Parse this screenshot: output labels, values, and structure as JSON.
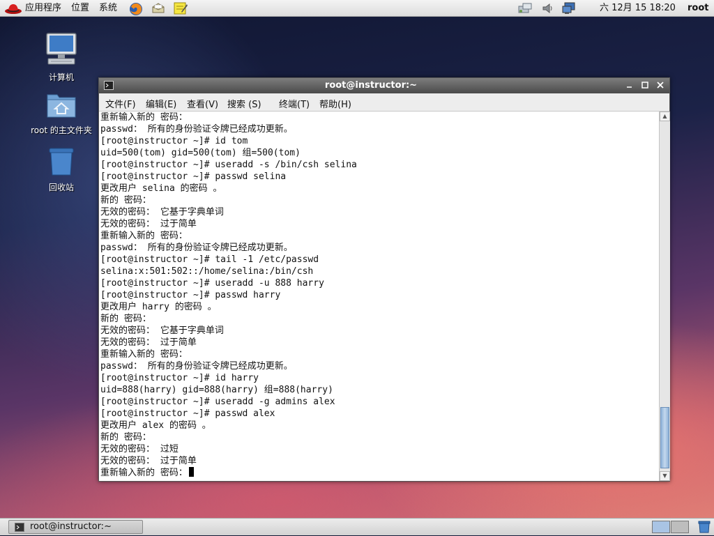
{
  "top_panel": {
    "menus": [
      "应用程序",
      "位置",
      "系统"
    ],
    "launchers": [
      "firefox-icon",
      "email-icon",
      "notes-icon"
    ],
    "tray_icons": [
      "network-icon",
      "volume-icon",
      "display-icon"
    ],
    "clock": "六 12月 15 18:20",
    "user": "root"
  },
  "desktop": {
    "icons": [
      {
        "name": "computer-icon",
        "label": "计算机"
      },
      {
        "name": "home-folder-icon",
        "label": "root 的主文件夹"
      },
      {
        "name": "trash-icon",
        "label": "回收站"
      }
    ]
  },
  "window": {
    "title": "root@instructor:~",
    "controls": {
      "minimize": "minimize-icon",
      "maximize": "maximize-icon",
      "close": "close-icon"
    },
    "menus": [
      "文件(F)",
      "编辑(E)",
      "查看(V)",
      "搜索 (S)",
      "终端(T)",
      "帮助(H)"
    ]
  },
  "terminal": {
    "lines": [
      "重新输入新的 密码：",
      "passwd： 所有的身份验证令牌已经成功更新。",
      "[root@instructor ~]# id tom",
      "uid=500(tom) gid=500(tom) 组=500(tom)",
      "[root@instructor ~]# useradd -s /bin/csh selina",
      "[root@instructor ~]# passwd selina",
      "更改用户 selina 的密码 。",
      "新的 密码：",
      "无效的密码： 它基于字典单词",
      "无效的密码： 过于简单",
      "重新输入新的 密码：",
      "passwd： 所有的身份验证令牌已经成功更新。",
      "[root@instructor ~]# tail -1 /etc/passwd",
      "selina:x:501:502::/home/selina:/bin/csh",
      "[root@instructor ~]# useradd -u 888 harry",
      "[root@instructor ~]# passwd harry",
      "更改用户 harry 的密码 。",
      "新的 密码：",
      "无效的密码： 它基于字典单词",
      "无效的密码： 过于简单",
      "重新输入新的 密码：",
      "passwd： 所有的身份验证令牌已经成功更新。",
      "[root@instructor ~]# id harry",
      "uid=888(harry) gid=888(harry) 组=888(harry)",
      "[root@instructor ~]# useradd -g admins alex",
      "[root@instructor ~]# passwd alex",
      "更改用户 alex 的密码 。",
      "新的 密码：",
      "无效的密码： 过短",
      "无效的密码： 过于简单",
      "重新输入新的 密码："
    ]
  },
  "taskbar": {
    "task_label": "root@instructor:~"
  },
  "colors": {
    "panel": "#e4e4e4",
    "titlebar": "#5a5a5a",
    "terminal_bg": "#ffffff",
    "scroll_thumb": "#a9c4e4"
  }
}
